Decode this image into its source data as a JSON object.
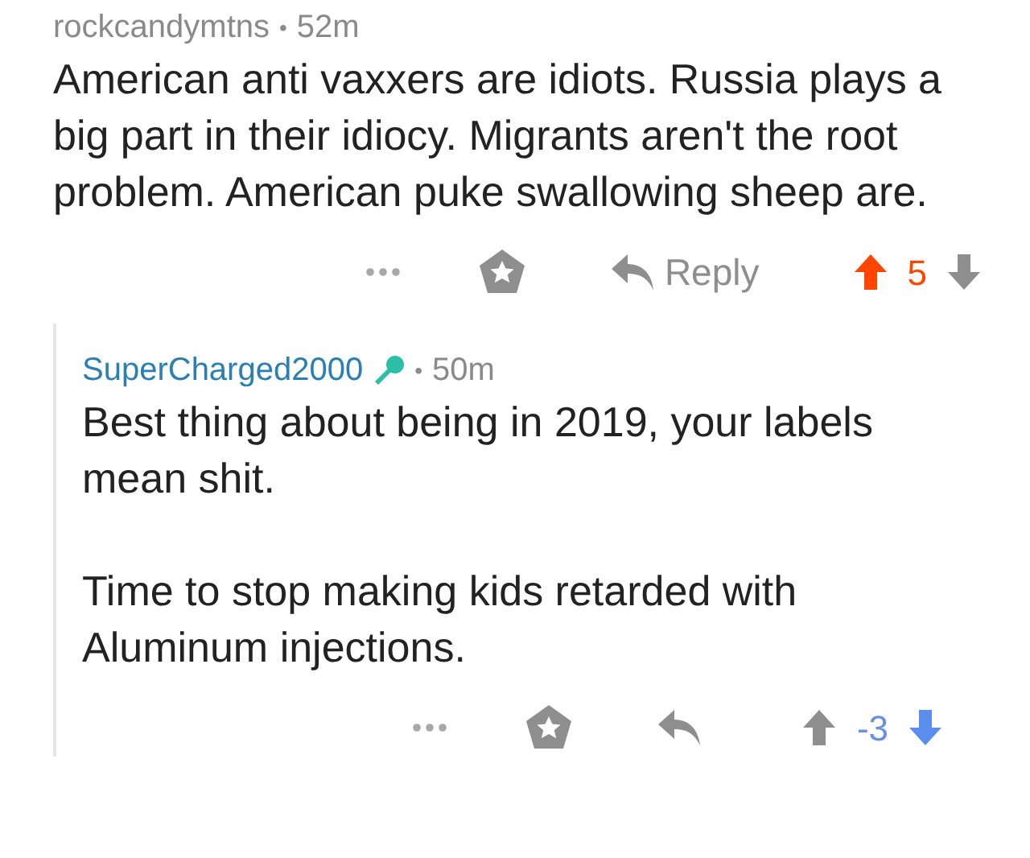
{
  "comments": [
    {
      "author": "rockcandymtns",
      "separator": "•",
      "time": "52m",
      "paragraphs": [
        "American anti vaxxers are idiots. Russia plays a big part in their idiocy. Migrants aren't the root problem. American puke swallowing sheep are."
      ],
      "reply_label": "Reply",
      "score": "5",
      "upvoted": true,
      "downvoted": false,
      "replies": [
        {
          "author": "SuperCharged2000",
          "flair": true,
          "separator": "•",
          "time": "50m",
          "paragraphs": [
            "Best thing about being in 2019, your labels mean shit.",
            "Time to stop making kids retarded with Aluminum injections."
          ],
          "score": "-3",
          "upvoted": false,
          "downvoted": true
        }
      ]
    }
  ]
}
